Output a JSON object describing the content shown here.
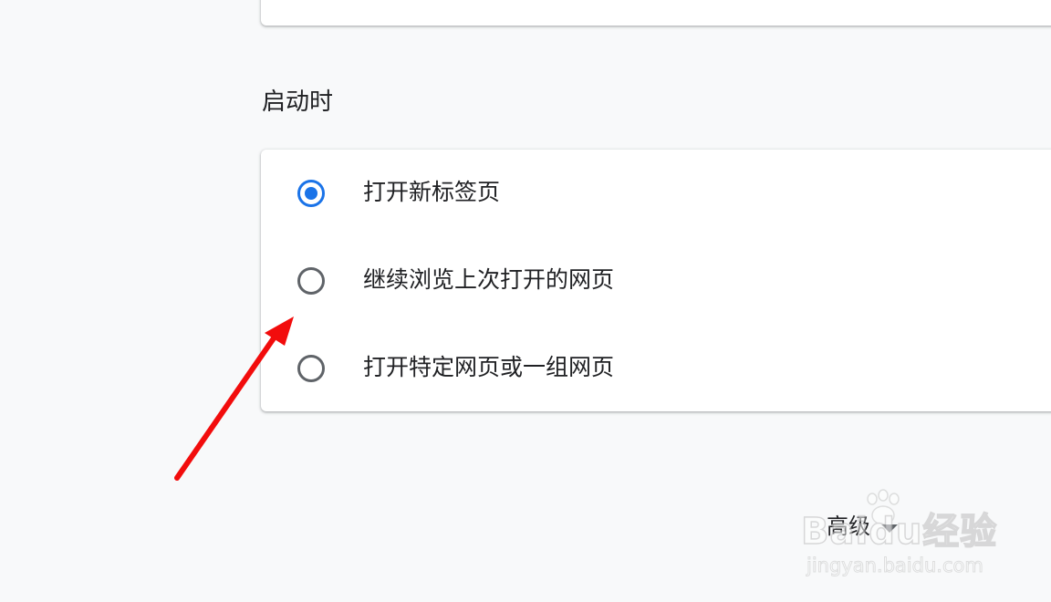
{
  "startup": {
    "title": "启动时",
    "options": [
      {
        "label": "打开新标签页",
        "checked": true
      },
      {
        "label": "继续浏览上次打开的网页",
        "checked": false
      },
      {
        "label": "打开特定网页或一组网页",
        "checked": false
      }
    ]
  },
  "advanced": {
    "label": "高级",
    "icon": "caret-down-icon"
  },
  "annotation": {
    "icon": "red-arrow-icon",
    "color": "#f20c0c"
  },
  "watermark": {
    "brand": "Baidu经验",
    "url": "jingyan.baidu.com",
    "icon": "paw-icon"
  },
  "colors": {
    "accent": "#1a73e8",
    "background": "#f8f9fa",
    "card": "#ffffff",
    "unchecked_radio": "#5f6368"
  }
}
